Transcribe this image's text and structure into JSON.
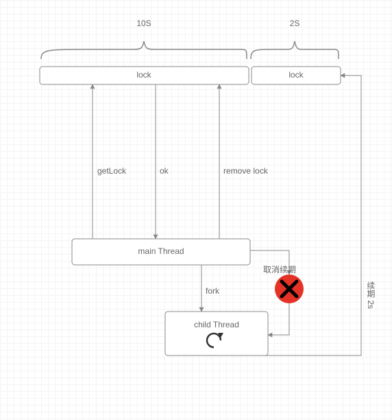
{
  "brace1_label": "10S",
  "brace2_label": "2S",
  "lock1": "lock",
  "lock2": "lock",
  "arrow_getlock": "getLock",
  "arrow_ok": "ok",
  "arrow_remove": "remove lock",
  "main_thread": "main Thread",
  "fork_label": "fork",
  "child_thread": "child Thread",
  "cancel_label": "取消续期",
  "renew_label": "续期 2s",
  "chart_data": {
    "type": "diagram",
    "nodes": [
      {
        "id": "lock1",
        "label": "lock",
        "span": "10S"
      },
      {
        "id": "lock2",
        "label": "lock",
        "span": "2S"
      },
      {
        "id": "main_thread",
        "label": "main Thread"
      },
      {
        "id": "child_thread",
        "label": "child Thread",
        "loop": true
      },
      {
        "id": "cancel",
        "label": "取消续期",
        "type": "cancel"
      }
    ],
    "edges": [
      {
        "from": "main_thread",
        "to": "lock1",
        "label": "getLock",
        "dir": "up"
      },
      {
        "from": "lock1",
        "to": "main_thread",
        "label": "ok",
        "dir": "down"
      },
      {
        "from": "main_thread",
        "to": "lock1",
        "label": "remove lock",
        "dir": "up"
      },
      {
        "from": "main_thread",
        "to": "child_thread",
        "label": "fork",
        "dir": "down"
      },
      {
        "from": "main_thread",
        "to": "cancel",
        "label": "",
        "dir": "down-right"
      },
      {
        "from": "cancel",
        "to": "child_thread",
        "label": "",
        "dir": "down"
      },
      {
        "from": "child_thread",
        "to": "lock2",
        "label": "续期 2s",
        "dir": "up-right"
      }
    ]
  }
}
